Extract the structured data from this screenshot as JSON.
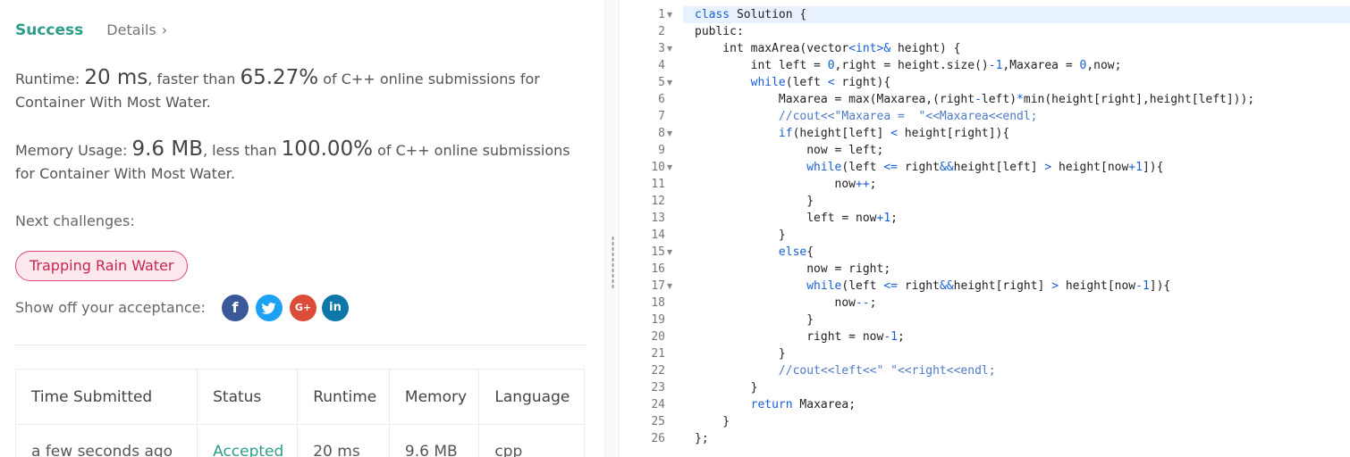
{
  "result": {
    "status": "Success",
    "details_label": "Details",
    "details_chevron": "›"
  },
  "runtime": {
    "prefix": "Runtime: ",
    "value": "20 ms",
    "mid": ", faster than ",
    "percent": "65.27%",
    "suffix": " of C++ online submissions for Container With Most Water."
  },
  "memory": {
    "prefix": "Memory Usage: ",
    "value": "9.6 MB",
    "mid": ", less than ",
    "percent": "100.00%",
    "suffix": " of C++ online submissions for Container With Most Water."
  },
  "next": {
    "label": "Next challenges:",
    "challenges": [
      "Trapping Rain Water"
    ]
  },
  "share": {
    "label": "Show off your acceptance:",
    "icons": [
      "facebook-icon",
      "twitter-icon",
      "google-plus-icon",
      "linkedin-icon"
    ],
    "glyphs": [
      "f",
      "t",
      "G+",
      "in"
    ]
  },
  "submissions": {
    "headers": [
      "Time Submitted",
      "Status",
      "Runtime",
      "Memory",
      "Language"
    ],
    "rows": [
      [
        "a few seconds ago",
        "Accepted",
        "20 ms",
        "9.6 MB",
        "cpp"
      ]
    ]
  },
  "editor": {
    "line_numbers": [
      "1",
      "2",
      "3",
      "4",
      "5",
      "6",
      "7",
      "8",
      "9",
      "10",
      "11",
      "12",
      "13",
      "14",
      "15",
      "16",
      "17",
      "18",
      "19",
      "20",
      "21",
      "22",
      "23",
      "24",
      "25",
      "26"
    ],
    "fold_lines": [
      1,
      3,
      5,
      8,
      10,
      15,
      17
    ],
    "code_lines": [
      "class Solution {",
      "public:",
      "    int maxArea(vector<int>& height) {",
      "        int left = 0,right = height.size()-1,Maxarea = 0,now;",
      "        while(left < right){",
      "            Maxarea = max(Maxarea,(right-left)*min(height[right],height[left]));",
      "            //cout<<\"Maxarea =  \"<<Maxarea<<endl;",
      "            if(height[left] < height[right]){",
      "                now = left;",
      "                while(left <= right&&height[left] > height[now+1]){",
      "                    now++;",
      "                }",
      "                left = now+1;",
      "            }",
      "            else{",
      "                now = right;",
      "                while(left <= right&&height[right] > height[now-1]){",
      "                    now--;",
      "                }",
      "                right = now-1;",
      "            }",
      "            //cout<<left<<\" \"<<right<<endl;",
      "        }",
      "        return Maxarea;",
      "    }",
      "};"
    ]
  }
}
